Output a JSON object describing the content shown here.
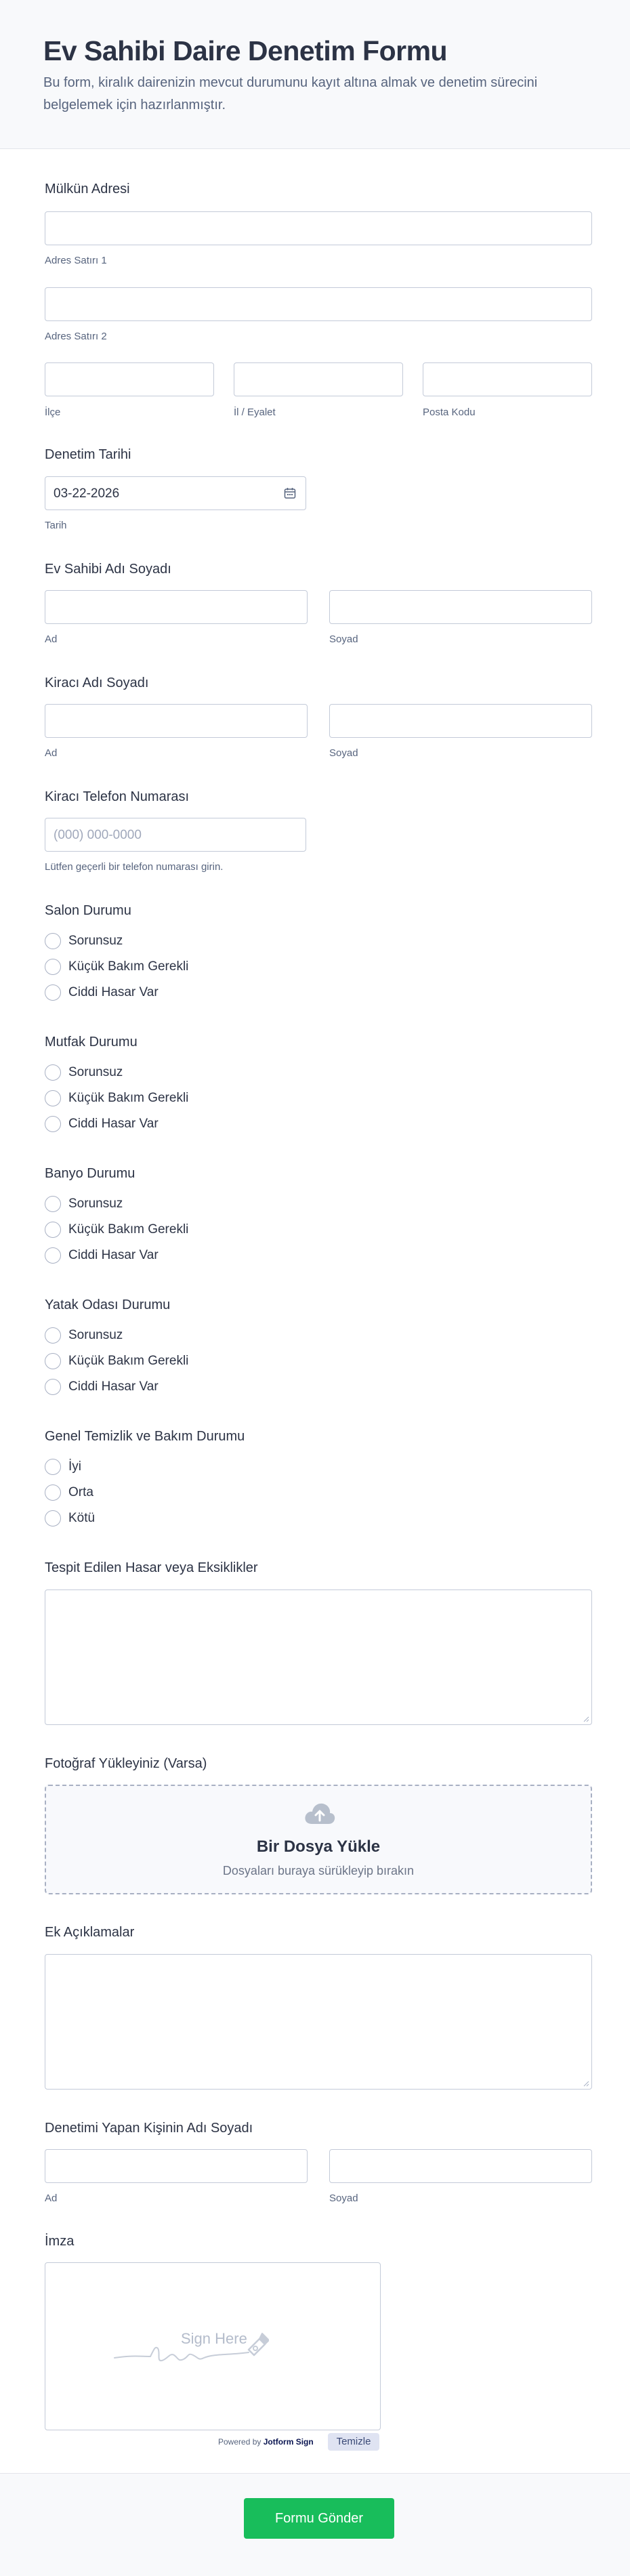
{
  "header": {
    "title": "Ev Sahibi Daire Denetim Formu",
    "description": "Bu form, kiralık dairenizin mevcut durumunu kayıt altına almak ve denetim sürecini belgelemek için hazırlanmıştır."
  },
  "address": {
    "label": "Mülkün Adresi",
    "line1_sublabel": "Adres Satırı 1",
    "line2_sublabel": "Adres Satırı 2",
    "city_sublabel": "İlçe",
    "state_sublabel": "İl / Eyalet",
    "postal_sublabel": "Posta Kodu"
  },
  "date": {
    "label": "Denetim Tarihi",
    "value": "03-22-2026",
    "sublabel": "Tarih",
    "icon": "calendar-icon"
  },
  "landlord": {
    "label": "Ev Sahibi Adı Soyadı",
    "first_sublabel": "Ad",
    "last_sublabel": "Soyad"
  },
  "tenant": {
    "label": "Kiracı Adı Soyadı",
    "first_sublabel": "Ad",
    "last_sublabel": "Soyad"
  },
  "phone": {
    "label": "Kiracı Telefon Numarası",
    "placeholder": "(000) 000-0000",
    "sublabel": "Lütfen geçerli bir telefon numarası girin."
  },
  "condition_groups": [
    {
      "label": "Salon Durumu",
      "options": [
        "Sorunsuz",
        "Küçük Bakım Gerekli",
        "Ciddi Hasar Var"
      ]
    },
    {
      "label": "Mutfak Durumu",
      "options": [
        "Sorunsuz",
        "Küçük Bakım Gerekli",
        "Ciddi Hasar Var"
      ]
    },
    {
      "label": "Banyo Durumu",
      "options": [
        "Sorunsuz",
        "Küçük Bakım Gerekli",
        "Ciddi Hasar Var"
      ]
    },
    {
      "label": "Yatak Odası Durumu",
      "options": [
        "Sorunsuz",
        "Küçük Bakım Gerekli",
        "Ciddi Hasar Var"
      ]
    },
    {
      "label": "Genel Temizlik ve Bakım Durumu",
      "options": [
        "İyi",
        "Orta",
        "Kötü"
      ]
    }
  ],
  "damage": {
    "label": "Tespit Edilen Hasar veya Eksiklikler"
  },
  "photo": {
    "label": "Fotoğraf Yükleyiniz (Varsa)",
    "upload_title": "Bir Dosya Yükle",
    "upload_sub": "Dosyaları buraya sürükleyip bırakın",
    "icon": "cloud-upload-icon"
  },
  "notes": {
    "label": "Ek Açıklamalar"
  },
  "inspector": {
    "label": "Denetimi Yapan Kişinin Adı Soyadı",
    "first_sublabel": "Ad",
    "last_sublabel": "Soyad"
  },
  "signature": {
    "label": "İmza",
    "placeholder": "Sign Here",
    "powered_prefix": "Powered by",
    "powered_brand": "Jotform Sign",
    "clear_label": "Temizle"
  },
  "submit_label": "Formu Gönder",
  "colors": {
    "submit": "#18bd5b",
    "text": "#2c3345",
    "sublabel": "#57647e",
    "border": "#c3cad8"
  }
}
